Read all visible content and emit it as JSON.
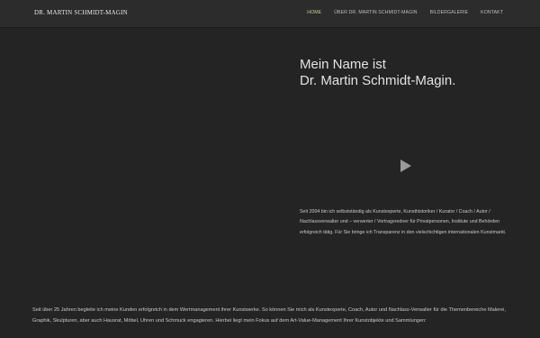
{
  "header": {
    "logo": "DR. MARTIN SCHMIDT-MAGIN",
    "nav": [
      {
        "label": "HOME",
        "active": true
      },
      {
        "label": "ÜBER DR. MARTIN SCHMIDT-MAGIN",
        "active": false
      },
      {
        "label": "BILDERGALERIE",
        "active": false
      },
      {
        "label": "KONTAKT",
        "active": false
      }
    ]
  },
  "hero": {
    "title_line1": "Mein Name ist",
    "title_line2": "Dr. Martin Schmidt-Magin.",
    "play_icon": "play-icon"
  },
  "intro": "Seit 2004 bin ich selbstständig als Kunstexperte, Kunsthistoriker / Kurator / Coach / Autor / Nachlassverwalter und – verwerter / Vortragsredner für Privatpersonen,  Institute und Behörden erfolgreich tätig. Für Sie bringe ich Transparenz in den vielschichtigen internationalen Kunstmarkt.",
  "body": "Seit über 25 Jahren begleite ich meine Kunden erfolgreich in dem Wertmanagement ihrer Kunstwerke. So können Sie mich als Kunstexperte, Coach, Autor und Nachlass-Verwalter für die Themenbereiche Malerei, Graphik, Skulpturen, aber auch Hausrat, Möbel, Uhren und Schmuck engagieren. Hierbei liegt mein Fokus auf dem Art-Value-Management Ihrer Kunstobjekte und Sammlungen:",
  "colors": {
    "background": "#242424",
    "header": "#2c2c2c",
    "nav_active": "#c7cf86"
  }
}
